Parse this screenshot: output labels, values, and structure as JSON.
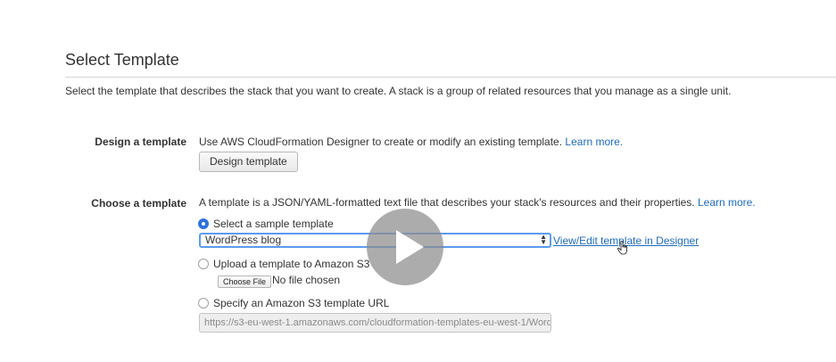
{
  "header": {
    "title": "Select Template",
    "description": "Select the template that describes the stack that you want to create. A stack is a group of related resources that you manage as a single unit."
  },
  "design_section": {
    "label": "Design a template",
    "text": "Use AWS CloudFormation Designer to create or modify an existing template.",
    "learn_more": "Learn more.",
    "button_label": "Design template"
  },
  "choose_section": {
    "label": "Choose a template",
    "text": "A template is a JSON/YAML-formatted text file that describes your stack's resources and their properties.",
    "learn_more": "Learn more.",
    "options": {
      "sample": {
        "label": "Select a sample template",
        "selected": true,
        "select_value": "WordPress blog",
        "designer_link": "View/Edit template in Designer"
      },
      "upload": {
        "label": "Upload a template to Amazon S3",
        "selected": false,
        "file_button": "Choose File",
        "file_status": "No file chosen"
      },
      "url": {
        "label": "Specify an Amazon S3 template URL",
        "selected": false,
        "placeholder": "https://s3-eu-west-1.amazonaws.com/cloudformation-templates-eu-west-1/Word"
      }
    }
  },
  "overlay": {
    "icon": "play-icon",
    "color": "#8c8c8c"
  },
  "colors": {
    "link": "#1f6bb8",
    "radio_selected": "#2e73d9",
    "focus_border": "#5b9bf0"
  }
}
